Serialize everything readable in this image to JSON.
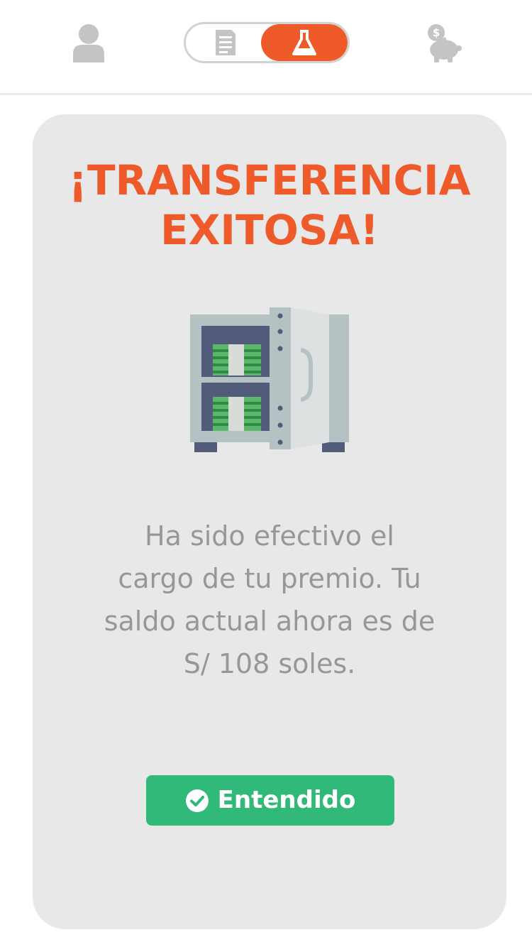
{
  "colors": {
    "accent": "#ee5a29",
    "success": "#31b97a",
    "card_bg": "#e8e8e9",
    "icon_gray": "#c4c4c4",
    "message_text": "#979797"
  },
  "topbar": {
    "left_icon": "user-profile-icon",
    "segments": [
      {
        "icon": "document-icon",
        "active": false
      },
      {
        "icon": "flask-icon",
        "active": true
      }
    ],
    "right_icon": "piggy-bank-icon"
  },
  "card": {
    "title_line1": "¡TRANSFERENCIA",
    "title_line2": "EXITOSA!",
    "illustration": "open-safe-with-money-icon",
    "message_line1": "Ha sido efectivo el",
    "message_line2": "cargo de tu premio. Tu",
    "message_line3": "saldo actual ahora es de",
    "message_line4": "S/ 108 soles.",
    "button_label": "Entendido",
    "button_icon": "check-circle-icon"
  }
}
